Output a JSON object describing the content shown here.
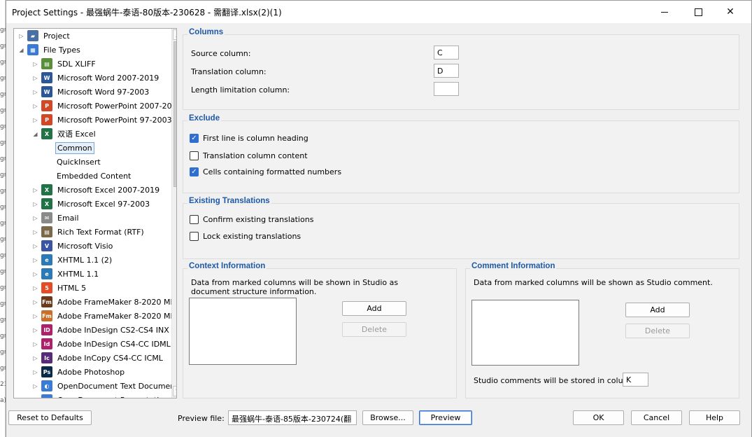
{
  "background_window": {
    "fragments": [
      "gr",
      "gr",
      "gr",
      "gr",
      "gr",
      "gr",
      "gr",
      "gr",
      "gr",
      "gr",
      "gr",
      "gr",
      "gr",
      "gr",
      "gr",
      "gr",
      "gr",
      "gr",
      "gr",
      "gr",
      "gr",
      "gr",
      "23",
      "a)"
    ]
  },
  "window": {
    "title": "Project Settings - 最强蜗牛-泰语-80版本-230628 - 需翻译.xlsx(2)(1)",
    "minimize_label": "—",
    "close_label": "✕"
  },
  "tree": {
    "items": [
      {
        "label": "Project",
        "icon": "project-icon",
        "color": "#4a6fa5"
      },
      {
        "label": "File Types",
        "icon": "file-types-icon",
        "color": "#3a7bd5"
      },
      {
        "label": "SDL XLIFF",
        "icon": "sdl-xliff-icon",
        "color": "#5a8f3a"
      },
      {
        "label": "Microsoft Word 2007-2019",
        "icon": "word-icon",
        "color": "#2b579a"
      },
      {
        "label": "Microsoft Word 97-2003",
        "icon": "word-legacy-icon",
        "color": "#2b579a"
      },
      {
        "label": "Microsoft PowerPoint 2007-20",
        "icon": "powerpoint-icon",
        "color": "#d24726"
      },
      {
        "label": "Microsoft PowerPoint 97-2003",
        "icon": "powerpoint-legacy-icon",
        "color": "#d24726"
      },
      {
        "label": "双语 Excel",
        "icon": "bilingual-excel-icon",
        "color": "#217346"
      },
      {
        "label": "Common",
        "icon": "",
        "color": ""
      },
      {
        "label": "QuickInsert",
        "icon": "",
        "color": ""
      },
      {
        "label": "Embedded Content",
        "icon": "",
        "color": ""
      },
      {
        "label": "Microsoft Excel 2007-2019",
        "icon": "excel-icon",
        "color": "#217346"
      },
      {
        "label": "Microsoft Excel 97-2003",
        "icon": "excel-legacy-icon",
        "color": "#217346"
      },
      {
        "label": "Email",
        "icon": "email-icon",
        "color": "#8a8a8a"
      },
      {
        "label": "Rich Text Format (RTF)",
        "icon": "rtf-icon",
        "color": "#7a6a4a"
      },
      {
        "label": "Microsoft Visio",
        "icon": "visio-icon",
        "color": "#3955a3"
      },
      {
        "label": "XHTML 1.1 (2)",
        "icon": "xhtml-icon",
        "color": "#2a7ab8"
      },
      {
        "label": "XHTML 1.1",
        "icon": "xhtml-icon",
        "color": "#2a7ab8"
      },
      {
        "label": "HTML 5",
        "icon": "html5-icon",
        "color": "#e34c26"
      },
      {
        "label": "Adobe FrameMaker 8-2020 MI",
        "icon": "framemaker-icon",
        "color": "#6a3a1a"
      },
      {
        "label": "Adobe FrameMaker 8-2020 MI",
        "icon": "framemaker-icon",
        "color": "#c8702a"
      },
      {
        "label": "Adobe InDesign CS2-CS4 INX",
        "icon": "indesign-icon",
        "color": "#b0206a"
      },
      {
        "label": "Adobe InDesign CS4-CC IDML",
        "icon": "indesign-icon",
        "color": "#b0206a"
      },
      {
        "label": "Adobe InCopy CS4-CC ICML",
        "icon": "incopy-icon",
        "color": "#5a2a7a"
      },
      {
        "label": "Adobe Photoshop",
        "icon": "photoshop-icon",
        "color": "#0a2a4a"
      },
      {
        "label": "OpenDocument Text Documen",
        "icon": "opendocument-icon",
        "color": "#3a7bd5"
      },
      {
        "label": "OpenDocument Presentation (",
        "icon": "opendocument-icon",
        "color": "#3a7bd5"
      }
    ],
    "icon_glyphs": [
      "▰",
      "▦",
      "▤",
      "W",
      "W",
      "P",
      "P",
      "X",
      "",
      "",
      "",
      "X",
      "X",
      "✉",
      "▤",
      "V",
      "e",
      "e",
      "5",
      "Fm",
      "Fm",
      "ID",
      "Id",
      "Ic",
      "Ps",
      "◐",
      "◐"
    ]
  },
  "columns": {
    "title": "Columns",
    "source_label": "Source column:",
    "source_value": "C",
    "translation_label": "Translation column:",
    "translation_value": "D",
    "length_label": "Length limitation column:",
    "length_value": ""
  },
  "exclude": {
    "title": "Exclude",
    "first_line": "First line is column heading",
    "first_line_checked": true,
    "translation_content": "Translation column content",
    "translation_content_checked": false,
    "formatted_numbers": "Cells containing formatted numbers",
    "formatted_numbers_checked": true
  },
  "existing": {
    "title": "Existing Translations",
    "confirm": "Confirm existing translations",
    "lock": "Lock existing translations"
  },
  "context": {
    "title": "Context Information",
    "description": "Data from marked columns will be shown in Studio as document structure information.",
    "add": "Add",
    "delete": "Delete"
  },
  "comment": {
    "title": "Comment Information",
    "description": "Data from marked columns will be shown as Studio comment.",
    "add": "Add",
    "delete": "Delete",
    "stored_label": "Studio comments will be stored in column:",
    "stored_value": "K"
  },
  "footer": {
    "reset": "Reset to Defaults",
    "preview_file_label": "Preview file:",
    "preview_file_value": "最强蜗牛-泰语-85版本-230724(翻",
    "browse": "Browse...",
    "preview": "Preview",
    "ok": "OK",
    "cancel": "Cancel",
    "help": "Help"
  },
  "colors": {
    "accent": "#2f6fcf",
    "group_title": "#1e5aa8"
  }
}
